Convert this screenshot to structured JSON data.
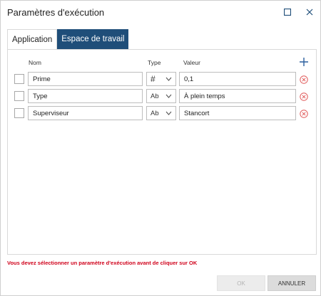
{
  "dialog": {
    "title": "Paramètres d'exécution"
  },
  "tabs": [
    {
      "label": "Application"
    },
    {
      "label": "Espace de travail"
    }
  ],
  "table": {
    "headers": {
      "name": "Nom",
      "type": "Type",
      "value": "Valeur"
    },
    "rows": [
      {
        "name": "Prime",
        "type": "#",
        "value": "0,1"
      },
      {
        "name": "Type",
        "type": "Ab",
        "value": "À plein temps"
      },
      {
        "name": "Superviseur",
        "type": "Ab",
        "value": "Stancort"
      }
    ]
  },
  "error_message": "Vous devez sélectionner un paramètre d'exécution avant de cliquer sur OK",
  "buttons": {
    "ok": "OK",
    "cancel": "ANNULER"
  },
  "colors": {
    "accent": "#1f4e79",
    "error": "#d0021b",
    "plus": "#2b5f9e",
    "delete": "#e05a5a"
  }
}
